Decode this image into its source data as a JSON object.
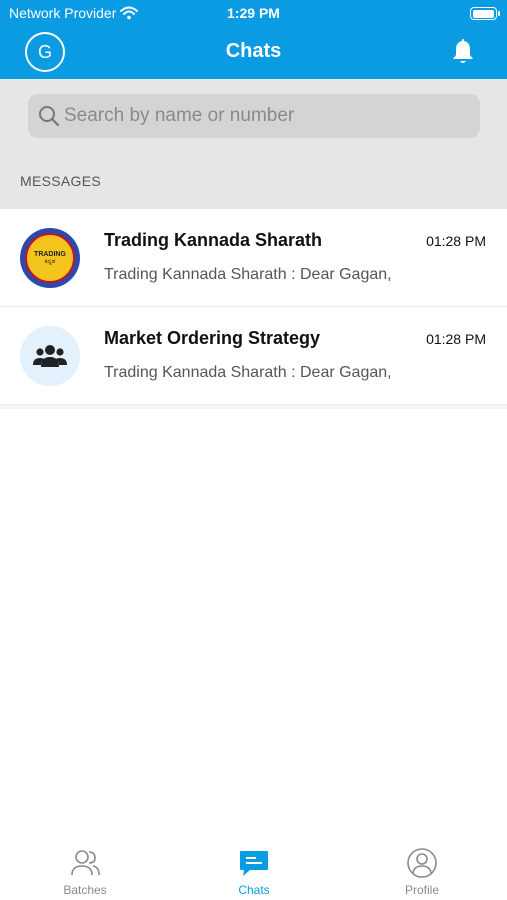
{
  "status_bar": {
    "carrier": "Network Provider",
    "time": "1:29 PM"
  },
  "header": {
    "avatar_initial": "G",
    "title": "Chats"
  },
  "search": {
    "placeholder": "Search by name or number"
  },
  "section_label": "MESSAGES",
  "chats": [
    {
      "name": "Trading Kannada Sharath",
      "time": "01:28 PM",
      "preview": "Trading Kannada Sharath : Dear Gagan,",
      "avatar_text_1": "TRADING",
      "avatar_text_2": "ಕನ್ನಡ"
    },
    {
      "name": "Market Ordering Strategy",
      "time": "01:28 PM",
      "preview": "Trading Kannada Sharath : Dear Gagan,"
    }
  ],
  "tabs": {
    "batches": "Batches",
    "chats": "Chats",
    "profile": "Profile"
  },
  "colors": {
    "primary": "#0a9be3",
    "search_bg": "#e6e6e6"
  }
}
